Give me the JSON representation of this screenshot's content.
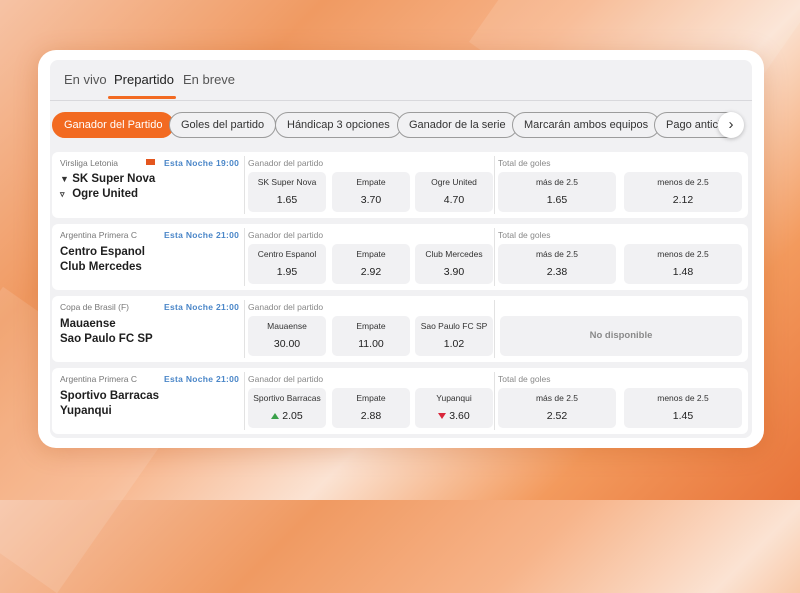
{
  "tabs": [
    "En vivo",
    "Prepartido",
    "En breve"
  ],
  "active_tab": "Prepartido",
  "filters": [
    "Ganador del Partido",
    "Goles del partido",
    "Hándicap 3 opciones",
    "Ganador de la serie",
    "Marcarán ambos equipos",
    "Pago anticip"
  ],
  "active_filter": "Ganador del Partido",
  "next_icon": "›",
  "colors": {
    "accent": "#f26a21",
    "time": "#4a86c8",
    "up": "#3aa04a",
    "down": "#d9263b"
  },
  "matches": [
    {
      "league": "Virsliga Letonia",
      "time": "Esta  Noche  19:00",
      "team1": "SK Super Nova",
      "team2": "Ogre United",
      "market1_title": "Ganador del partido",
      "outcomes": [
        {
          "label": "SK Super Nova",
          "odd": "1.65"
        },
        {
          "label": "Empate",
          "odd": "3.70"
        },
        {
          "label": "Ogre United",
          "odd": "4.70"
        }
      ],
      "market2_title": "Total de goles",
      "totals": [
        {
          "label": "más de 2.5",
          "odd": "1.65"
        },
        {
          "label": "menos de 2.5",
          "odd": "2.12"
        }
      ]
    },
    {
      "league": "Argentina Primera C",
      "time": "Esta  Noche  21:00",
      "team1": "Centro Espanol",
      "team2": "Club Mercedes",
      "market1_title": "Ganador del partido",
      "outcomes": [
        {
          "label": "Centro Espanol",
          "odd": "1.95"
        },
        {
          "label": "Empate",
          "odd": "2.92"
        },
        {
          "label": "Club Mercedes",
          "odd": "3.90"
        }
      ],
      "market2_title": "Total de goles",
      "totals": [
        {
          "label": "más de 2.5",
          "odd": "2.38"
        },
        {
          "label": "menos de 2.5",
          "odd": "1.48"
        }
      ]
    },
    {
      "league": "Copa de Brasil (F)",
      "time": "Esta  Noche  21:00",
      "team1": "Mauaense",
      "team2": "Sao Paulo FC SP",
      "market1_title": "Ganador del partido",
      "outcomes": [
        {
          "label": "Mauaense",
          "odd": "30.00"
        },
        {
          "label": "Empate",
          "odd": "11.00"
        },
        {
          "label": "Sao Paulo FC SP",
          "odd": "1.02"
        }
      ],
      "unavailable": "No disponible"
    },
    {
      "league": "Argentina Primera C",
      "time": "Esta  Noche  21:00",
      "team1": "Sportivo Barracas",
      "team2": "Yupanqui",
      "market1_title": "Ganador del partido",
      "outcomes": [
        {
          "label": "Sportivo Barracas",
          "odd": "2.05",
          "trend": "up"
        },
        {
          "label": "Empate",
          "odd": "2.88"
        },
        {
          "label": "Yupanqui",
          "odd": "3.60",
          "trend": "down"
        }
      ],
      "market2_title": "Total de goles",
      "totals": [
        {
          "label": "más de 2.5",
          "odd": "2.52"
        },
        {
          "label": "menos de 2.5",
          "odd": "1.45"
        }
      ]
    }
  ]
}
